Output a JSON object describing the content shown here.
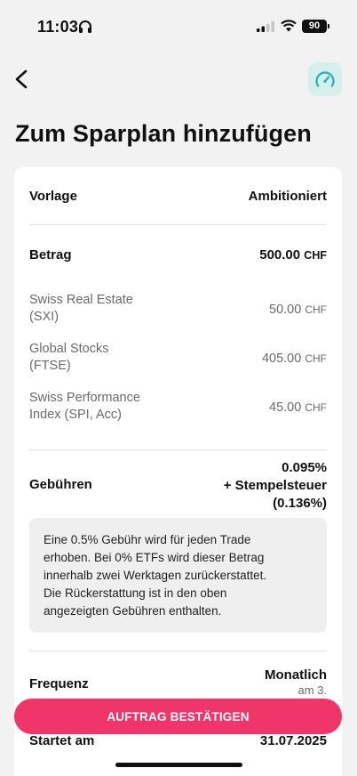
{
  "status_bar": {
    "time": "11:03",
    "battery": "90"
  },
  "header": {
    "title": "Zum Sparplan hinzufügen"
  },
  "summary": {
    "template": {
      "label": "Vorlage",
      "value": "Ambitioniert"
    },
    "amount": {
      "label": "Betrag",
      "value": "500.00",
      "unit": "CHF"
    },
    "allocations": [
      {
        "name_line1": "Swiss Real Estate",
        "name_line2": "(SXI)",
        "value": "50.00",
        "unit": "CHF"
      },
      {
        "name_line1": "Global Stocks",
        "name_line2": "(FTSE)",
        "value": "405.00",
        "unit": "CHF"
      },
      {
        "name_line1": "Swiss Performance",
        "name_line2": "Index (SPI, Acc)",
        "value": "45.00",
        "unit": "CHF"
      }
    ],
    "fees": {
      "label": "Gebühren",
      "value_line1": "0.095%",
      "value_line2": "+ Stempelsteuer",
      "value_line3": "(0.136%)"
    },
    "fee_info": {
      "line1": "Eine 0.5% Gebühr wird für jeden Trade",
      "line2": "erhoben. Bei 0% ETFs wird dieser Betrag",
      "line3": "innerhalb zwei Werktagen zurückerstattet.",
      "line4": "Die Rückerstattung ist in den oben",
      "line5": "angezeigten Gebühren enthalten."
    },
    "frequency": {
      "label": "Frequenz",
      "value": "Monatlich",
      "sub": "am 3."
    },
    "start": {
      "label": "Startet am",
      "value": "31.07.2025"
    }
  },
  "actions": {
    "confirm_label": "AUFTRAG BESTÄTIGEN"
  },
  "colors": {
    "accent": "#f0356a",
    "icon_bg": "#d6efee",
    "icon_fg": "#2bb3ad"
  },
  "icons": {
    "back": "chevron-left-icon",
    "plan": "speedometer-icon"
  }
}
